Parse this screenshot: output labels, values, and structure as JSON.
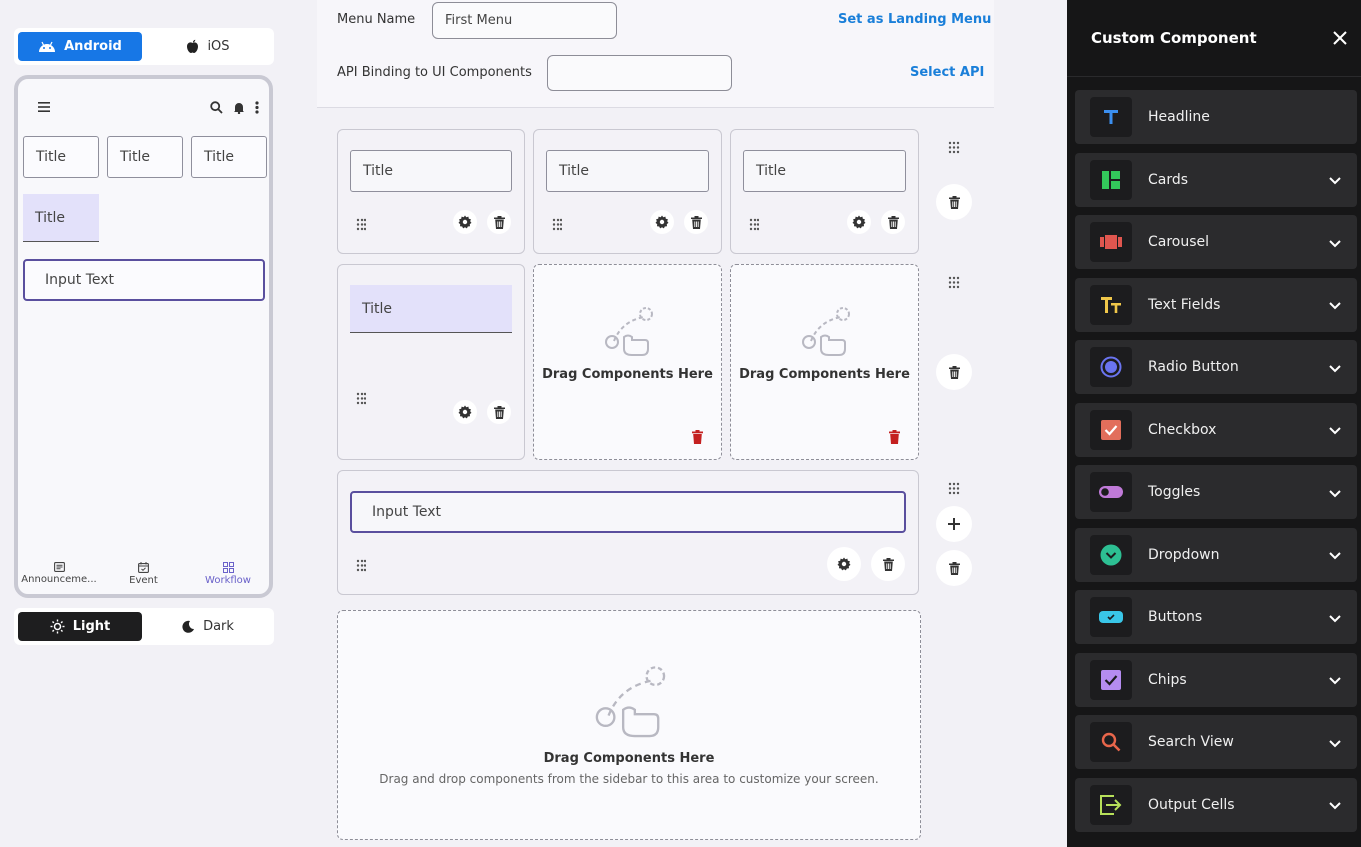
{
  "preview": {
    "platform": {
      "android": "Android",
      "ios": "iOS"
    },
    "phone": {
      "titles": [
        "Title",
        "Title",
        "Title"
      ],
      "filled_title": "Title",
      "input": "Input Text",
      "tabs": [
        "Announceme...",
        "Event",
        "Workflow"
      ]
    },
    "theme": {
      "light": "Light",
      "dark": "Dark"
    }
  },
  "editor": {
    "menu_name_label": "Menu Name",
    "menu_name_value": "First Menu",
    "landing_link": "Set as Landing Menu",
    "api_label": "API Binding to UI Components",
    "api_value": "",
    "select_api": "Select API",
    "row1_titles": [
      "Title",
      "Title",
      "Title"
    ],
    "row2_title": "Title",
    "drop_label": "Drag Components Here",
    "row3_input": "Input Text",
    "big_drop_title": "Drag Components Here",
    "big_drop_sub": "Drag and drop components from the sidebar to this area to customize your screen."
  },
  "sidebar": {
    "title": "Custom Component",
    "items": [
      {
        "label": "Headline",
        "icon": "headline-icon",
        "color": "#3b8ff0"
      },
      {
        "label": "Cards",
        "icon": "cards-icon",
        "color": "#33c85b"
      },
      {
        "label": "Carousel",
        "icon": "carousel-icon",
        "color": "#e0564f"
      },
      {
        "label": "Text Fields",
        "icon": "text-fields-icon",
        "color": "#f0c74a"
      },
      {
        "label": "Radio Button",
        "icon": "radio-button-icon",
        "color": "#6a74f0"
      },
      {
        "label": "Checkbox",
        "icon": "checkbox-icon",
        "color": "#e26e5b"
      },
      {
        "label": "Toggles",
        "icon": "toggle-icon",
        "color": "#c07ad8"
      },
      {
        "label": "Dropdown",
        "icon": "dropdown-icon",
        "color": "#2dbf93"
      },
      {
        "label": "Buttons",
        "icon": "buttons-icon",
        "color": "#39c6e8"
      },
      {
        "label": "Chips",
        "icon": "chips-icon",
        "color": "#b58cf0"
      },
      {
        "label": "Search View",
        "icon": "search-view-icon",
        "color": "#e8664b"
      },
      {
        "label": "Output Cells",
        "icon": "output-cells-icon",
        "color": "#b7e05a"
      }
    ]
  }
}
